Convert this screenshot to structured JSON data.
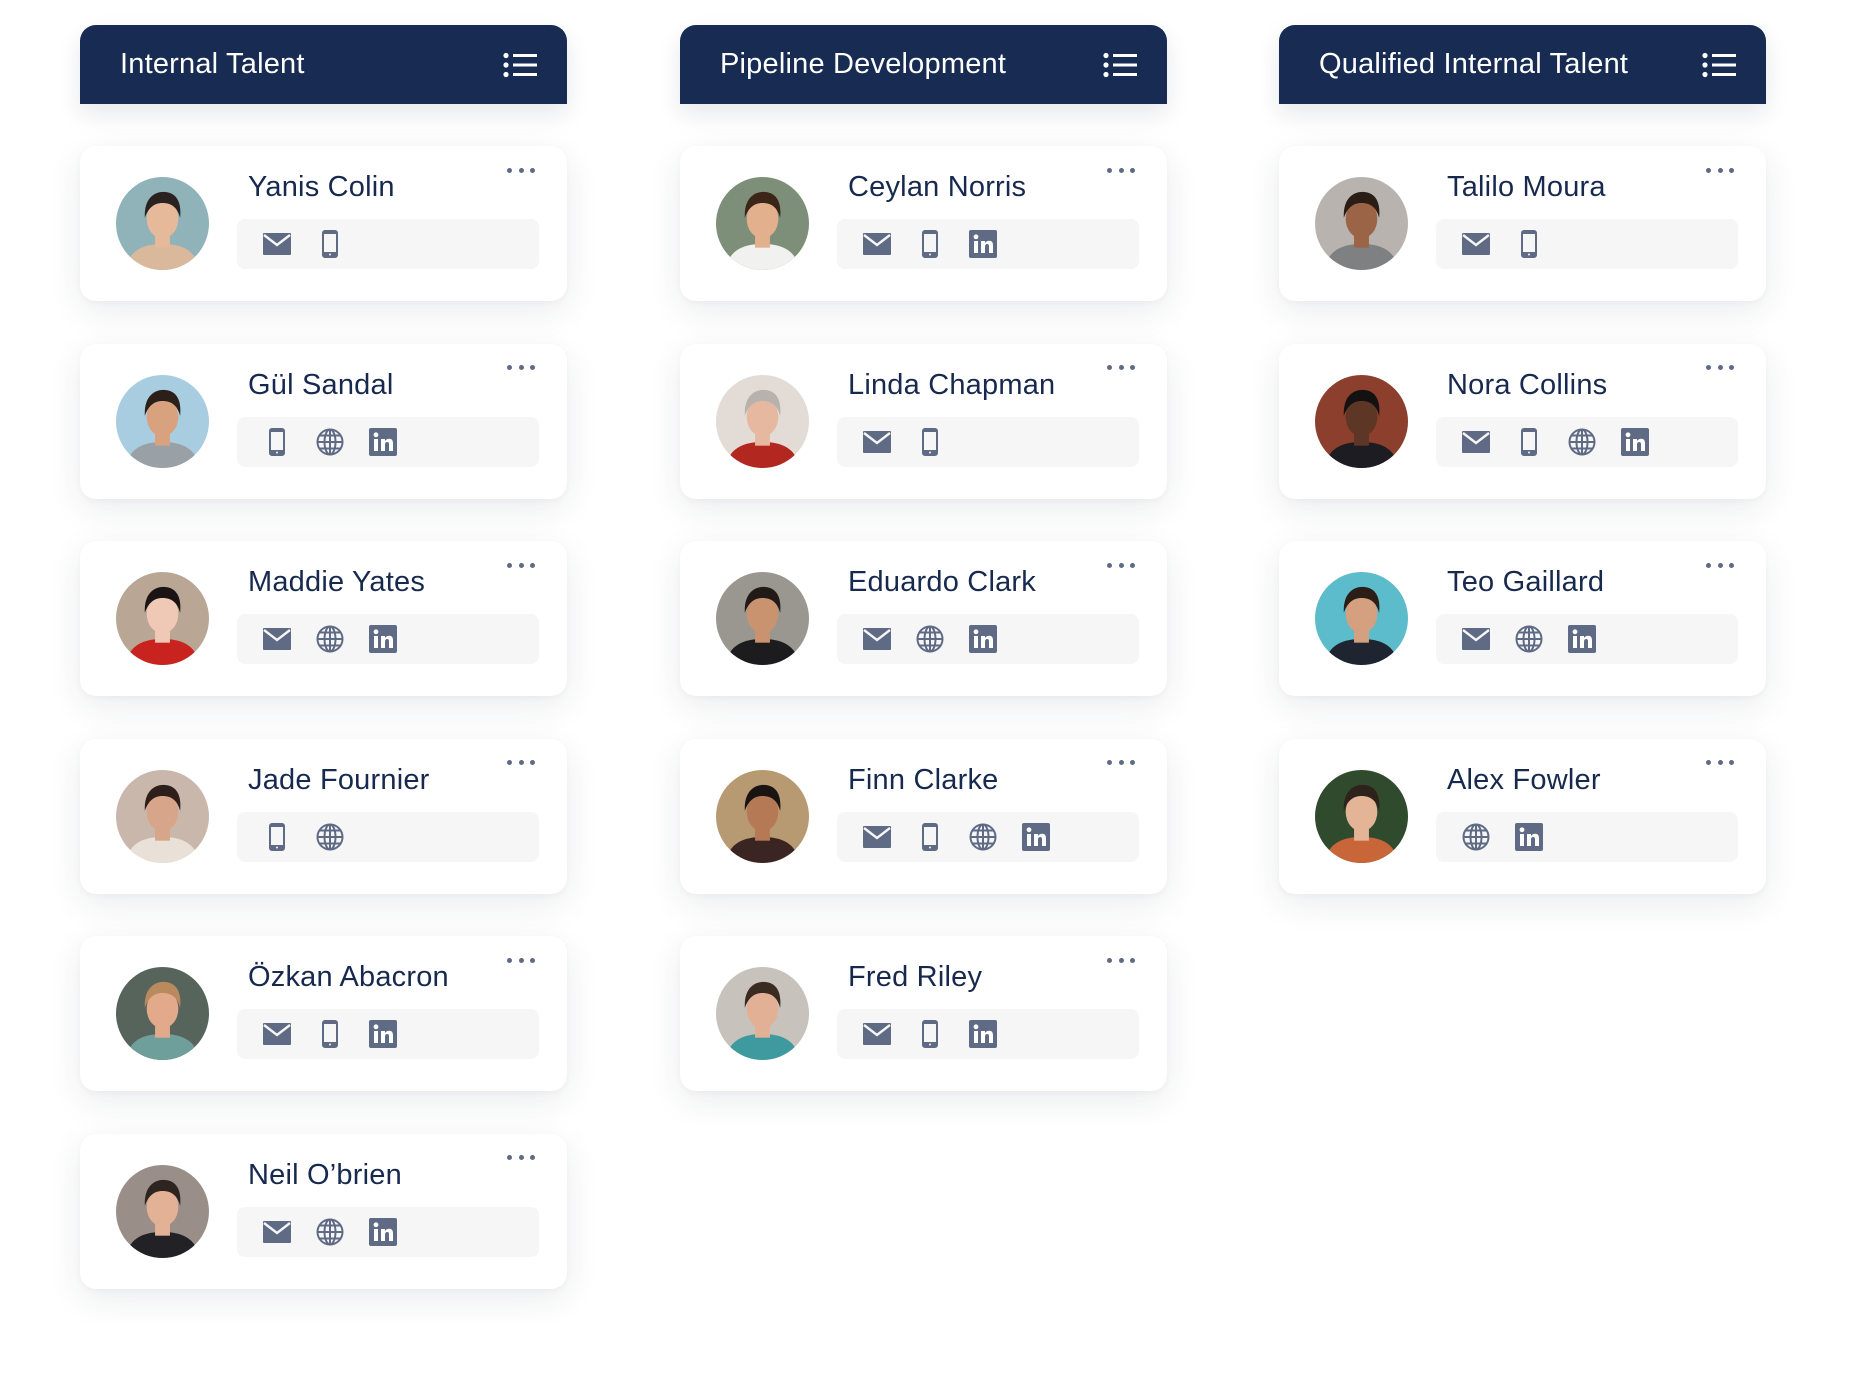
{
  "board": {
    "icon_color": "#5f6b85",
    "header_color": "#172b53",
    "name_color": "#17294f",
    "columns": [
      {
        "title": "Internal Talent",
        "menu_icon": "list-icon",
        "cards": [
          {
            "name": "Yanis Colin",
            "avatar": {
              "bg": "#8fb3b8",
              "skin": "#e6b99a",
              "hair": "#2a2220",
              "shirt": "#d9b89c"
            },
            "contacts": [
              "email",
              "phone"
            ]
          },
          {
            "name": "Gül Sandal",
            "avatar": {
              "bg": "#a9cde0",
              "skin": "#d9a27e",
              "hair": "#2b2019",
              "shirt": "#9aa1a6"
            },
            "contacts": [
              "phone",
              "web",
              "linkedin"
            ]
          },
          {
            "name": "Maddie Yates",
            "avatar": {
              "bg": "#b9a694",
              "skin": "#efc9b6",
              "hair": "#1a1414",
              "shirt": "#c9231f"
            },
            "contacts": [
              "email",
              "web",
              "linkedin"
            ]
          },
          {
            "name": "Jade Fournier",
            "avatar": {
              "bg": "#c9b7ac",
              "skin": "#d7a58a",
              "hair": "#2e1f1a",
              "shirt": "#e9e0d8"
            },
            "contacts": [
              "phone",
              "web"
            ]
          },
          {
            "name": "Özkan Abacron",
            "avatar": {
              "bg": "#57645c",
              "skin": "#e2a98b",
              "hair": "#b98a5e",
              "shirt": "#6f9f9b"
            },
            "contacts": [
              "email",
              "phone",
              "linkedin"
            ]
          },
          {
            "name": "Neil O’brien",
            "avatar": {
              "bg": "#9a8f88",
              "skin": "#e3b296",
              "hair": "#2f2520",
              "shirt": "#222226"
            },
            "contacts": [
              "email",
              "web",
              "linkedin"
            ]
          }
        ]
      },
      {
        "title": "Pipeline Development",
        "menu_icon": "list-icon",
        "cards": [
          {
            "name": "Ceylan Norris",
            "avatar": {
              "bg": "#7d8f78",
              "skin": "#e3b08d",
              "hair": "#3b2418",
              "shirt": "#f1f1ef"
            },
            "contacts": [
              "email",
              "phone",
              "linkedin"
            ]
          },
          {
            "name": "Linda Chapman",
            "avatar": {
              "bg": "#e3dcd6",
              "skin": "#e6b8a0",
              "hair": "#b7b2ad",
              "shirt": "#b2271f"
            },
            "contacts": [
              "email",
              "phone"
            ]
          },
          {
            "name": "Eduardo Clark",
            "avatar": {
              "bg": "#9a9690",
              "skin": "#c9936f",
              "hair": "#221a16",
              "shirt": "#1c1c1e"
            },
            "contacts": [
              "email",
              "web",
              "linkedin"
            ]
          },
          {
            "name": "Finn Clarke",
            "avatar": {
              "bg": "#b89a72",
              "skin": "#b57a55",
              "hair": "#1a1412",
              "shirt": "#3b2522"
            },
            "contacts": [
              "email",
              "phone",
              "web",
              "linkedin"
            ]
          },
          {
            "name": "Fred Riley",
            "avatar": {
              "bg": "#c7c2bb",
              "skin": "#e2b195",
              "hair": "#3a2b22",
              "shirt": "#3f9aa0"
            },
            "contacts": [
              "email",
              "phone",
              "linkedin"
            ]
          }
        ]
      },
      {
        "title": "Qualified Internal Talent",
        "menu_icon": "list-icon",
        "cards": [
          {
            "name": "Talilo Moura",
            "avatar": {
              "bg": "#b8b3ae",
              "skin": "#9c6446",
              "hair": "#2a1d16",
              "shirt": "#7f8082"
            },
            "contacts": [
              "email",
              "phone"
            ]
          },
          {
            "name": "Nora Collins",
            "avatar": {
              "bg": "#8b3f2c",
              "skin": "#5e3626",
              "hair": "#141112",
              "shirt": "#1c1c22"
            },
            "contacts": [
              "email",
              "phone",
              "web",
              "linkedin"
            ]
          },
          {
            "name": "Teo Gaillard",
            "avatar": {
              "bg": "#5cbccb",
              "skin": "#d5a07f",
              "hair": "#2b1e17",
              "shirt": "#1e2430"
            },
            "contacts": [
              "email",
              "web",
              "linkedin"
            ]
          },
          {
            "name": "Alex Fowler",
            "avatar": {
              "bg": "#2f4a2c",
              "skin": "#e4b497",
              "hair": "#2e221c",
              "shirt": "#c8663a"
            },
            "contacts": [
              "web",
              "linkedin"
            ]
          }
        ]
      }
    ]
  }
}
